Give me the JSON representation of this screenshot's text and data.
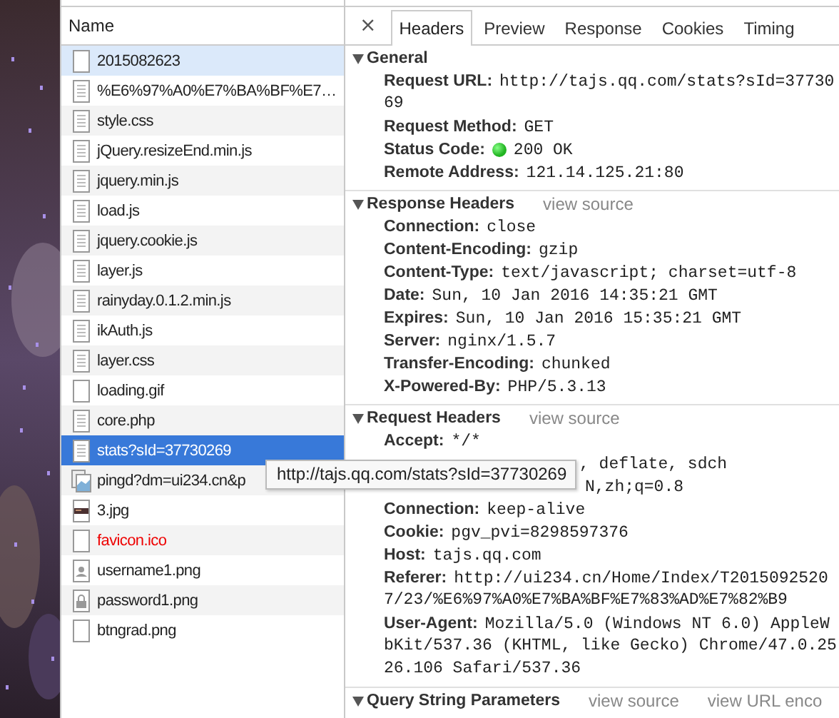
{
  "requests": {
    "column": "Name",
    "items": [
      {
        "name": "2015082623",
        "kind": "blank",
        "highlighted": true,
        "selected": false,
        "failed": false
      },
      {
        "name": "%E6%97%A0%E7%BA%BF%E7…",
        "kind": "document",
        "highlighted": false,
        "selected": false,
        "failed": false
      },
      {
        "name": "style.css",
        "kind": "document",
        "highlighted": false,
        "selected": false,
        "failed": false
      },
      {
        "name": "jQuery.resizeEnd.min.js",
        "kind": "document",
        "highlighted": false,
        "selected": false,
        "failed": false
      },
      {
        "name": "jquery.min.js",
        "kind": "document",
        "highlighted": false,
        "selected": false,
        "failed": false
      },
      {
        "name": "load.js",
        "kind": "document",
        "highlighted": false,
        "selected": false,
        "failed": false
      },
      {
        "name": "jquery.cookie.js",
        "kind": "document",
        "highlighted": false,
        "selected": false,
        "failed": false
      },
      {
        "name": "layer.js",
        "kind": "document",
        "highlighted": false,
        "selected": false,
        "failed": false
      },
      {
        "name": "rainyday.0.1.2.min.js",
        "kind": "document",
        "highlighted": false,
        "selected": false,
        "failed": false
      },
      {
        "name": "ikAuth.js",
        "kind": "document",
        "highlighted": false,
        "selected": false,
        "failed": false
      },
      {
        "name": "layer.css",
        "kind": "document",
        "highlighted": false,
        "selected": false,
        "failed": false
      },
      {
        "name": "loading.gif",
        "kind": "blank",
        "highlighted": false,
        "selected": false,
        "failed": false
      },
      {
        "name": "core.php",
        "kind": "document",
        "highlighted": false,
        "selected": false,
        "failed": false
      },
      {
        "name": "stats?sId=37730269",
        "kind": "document",
        "highlighted": false,
        "selected": true,
        "failed": false
      },
      {
        "name": "pingd?dm=ui234.cn&p",
        "kind": "images",
        "highlighted": false,
        "selected": false,
        "failed": false
      },
      {
        "name": "3.jpg",
        "highlighted": false,
        "selected": false,
        "failed": false
      },
      {
        "name": "favicon.ico",
        "kind": "blank",
        "highlighted": false,
        "selected": false,
        "failed": true
      },
      {
        "name": "username1.png",
        "kind": "user",
        "highlighted": false,
        "selected": false,
        "failed": false
      },
      {
        "name": "password1.png",
        "kind": "lock",
        "highlighted": false,
        "selected": false,
        "failed": false
      },
      {
        "name": "btngrad.png",
        "kind": "blank",
        "highlighted": false,
        "selected": false,
        "failed": false
      }
    ]
  },
  "tooltip": "http://tajs.qq.com/stats?sId=37730269",
  "details": {
    "close": "×",
    "tabs": [
      {
        "label": "Headers",
        "selected": true
      },
      {
        "label": "Preview",
        "selected": false
      },
      {
        "label": "Response",
        "selected": false
      },
      {
        "label": "Cookies",
        "selected": false
      },
      {
        "label": "Timing",
        "selected": false
      }
    ],
    "sections": [
      {
        "title": "General",
        "expanded": true,
        "rows": [
          {
            "kind": "field",
            "name": "Request URL:",
            "value": [
              "http://tajs.qq.com/stats?sId=37730",
              "69"
            ]
          },
          {
            "kind": "field",
            "name": "Request Method:",
            "value": [
              "GET"
            ]
          },
          {
            "kind": "status",
            "name": "Status Code:",
            "value": [
              "200 OK"
            ]
          },
          {
            "kind": "field",
            "name": "Remote Address:",
            "value": [
              "121.14.125.21:80"
            ]
          }
        ]
      },
      {
        "title": "Response Headers",
        "expanded": true,
        "links": [
          "view source"
        ],
        "rows": [
          {
            "kind": "field",
            "name": "Connection:",
            "value": [
              "close"
            ]
          },
          {
            "kind": "field",
            "name": "Content-Encoding:",
            "value": [
              "gzip"
            ]
          },
          {
            "kind": "field",
            "name": "Content-Type:",
            "value": [
              "text/javascript; charset=utf-8"
            ]
          },
          {
            "kind": "field",
            "name": "Date:",
            "value": [
              "Sun, 10 Jan 2016 14:35:21 GMT"
            ]
          },
          {
            "kind": "field",
            "name": "Expires:",
            "value": [
              "Sun, 10 Jan 2016 15:35:21 GMT"
            ]
          },
          {
            "kind": "field",
            "name": "Server:",
            "value": [
              "nginx/1.5.7"
            ]
          },
          {
            "kind": "field",
            "name": "Transfer-Encoding:",
            "value": [
              "chunked"
            ]
          },
          {
            "kind": "field",
            "name": "X-Powered-By:",
            "value": [
              "PHP/5.3.13"
            ]
          }
        ]
      },
      {
        "title": "Request Headers",
        "expanded": true,
        "links": [
          "view source"
        ],
        "rows": [
          {
            "kind": "field",
            "name": "Accept:",
            "value": [
              "*/*"
            ]
          },
          {
            "kind": "covered",
            "value": [
              ", deflate, sdch"
            ]
          },
          {
            "kind": "covered2",
            "value": [
              "N,zh;q=0.8"
            ]
          },
          {
            "kind": "field",
            "name": "Connection:",
            "value": [
              "keep-alive"
            ]
          },
          {
            "kind": "field",
            "name": "Cookie:",
            "value": [
              "pgv_pvi=8298597376"
            ]
          },
          {
            "kind": "field",
            "name": "Host:",
            "value": [
              "tajs.qq.com"
            ]
          },
          {
            "kind": "field",
            "name": "Referer:",
            "value": [
              "http://ui234.cn/Home/Index/T2015092520",
              "7/23/%E6%97%A0%E7%BA%BF%E7%83%AD%E7%82%B9"
            ]
          },
          {
            "kind": "field",
            "name": "User-Agent:",
            "value": [
              "Mozilla/5.0 (Windows NT 6.0) AppleW",
              "bKit/537.36 (KHTML, like Gecko) Chrome/47.0.25",
              "26.106 Safari/537.36"
            ]
          }
        ]
      },
      {
        "title": "Query String Parameters",
        "expanded": true,
        "links": [
          "view source",
          "view URL enco"
        ]
      }
    ]
  }
}
